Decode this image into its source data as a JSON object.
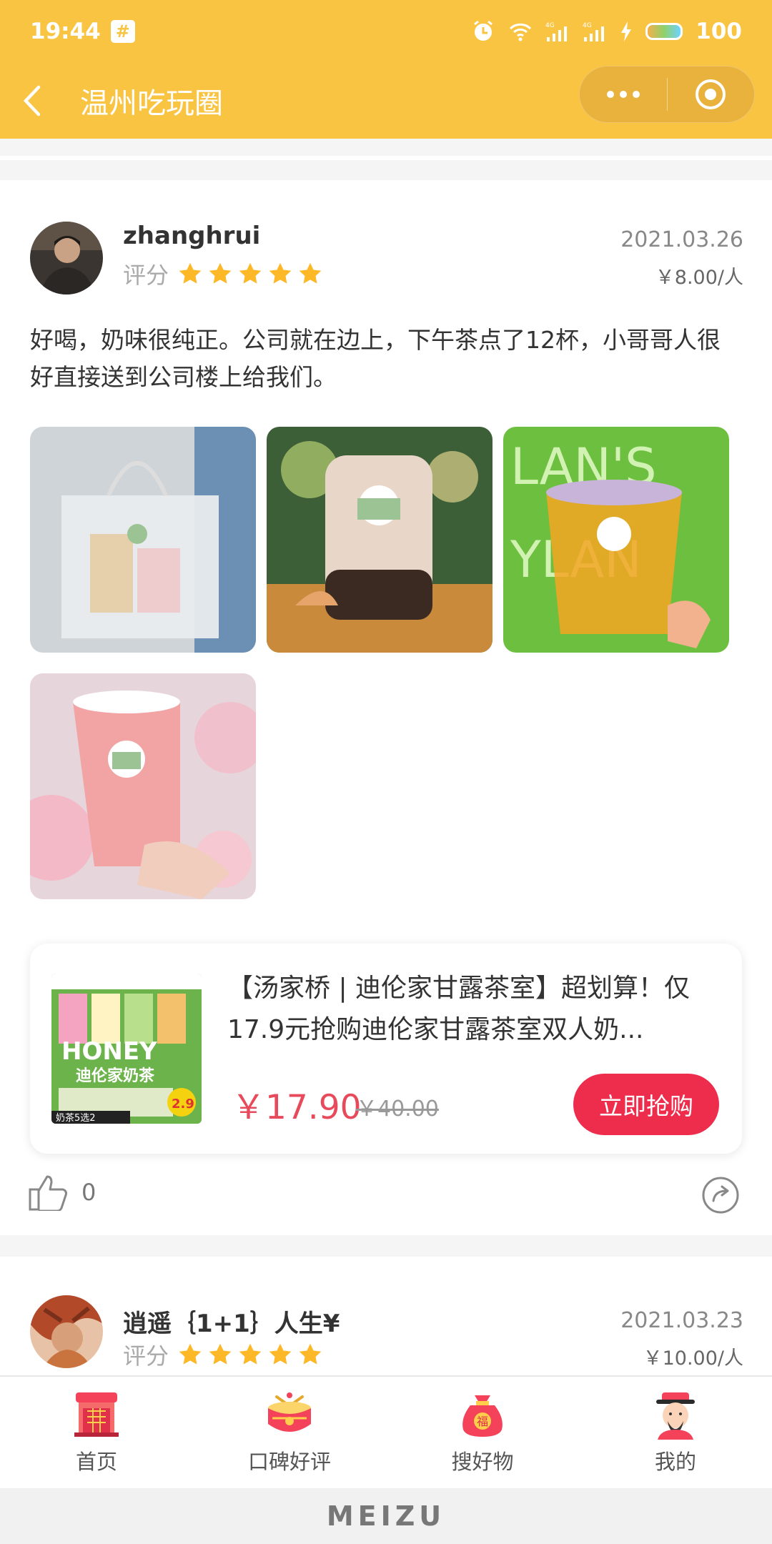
{
  "status_bar": {
    "time": "19:44",
    "hash_icon": "#",
    "battery": "100"
  },
  "nav": {
    "title": "温州吃玩圈"
  },
  "review1": {
    "username": "zhanghrui",
    "rating_label": "评分",
    "stars": 5,
    "date": "2021.03.26",
    "price_per": "￥8.00/人",
    "text": "好喝，奶味很纯正。公司就在边上，下午茶点了12杯，小哥哥人很好直接送到公司楼上给我们。",
    "photo_count": 4
  },
  "deal": {
    "title": "【汤家桥 | 迪伦家甘露茶室】超划算！仅17.9元抢购迪伦家甘露茶室双人奶...",
    "price": "￥17.90",
    "original_price": "￥40.00",
    "buy_label": "立即抢购",
    "image_text": "迪伦家奶茶",
    "image_tag": "奶茶5选2",
    "image_price": "2.9"
  },
  "actions": {
    "like_count": "0"
  },
  "review2": {
    "username": "逍遥｛1+1｝人生¥",
    "rating_label": "评分",
    "stars": 5,
    "date": "2021.03.23",
    "price_per": "￥10.00/人"
  },
  "tabbar": {
    "tabs": [
      {
        "label": "首页",
        "icon": "home-icon"
      },
      {
        "label": "口碑好评",
        "icon": "drum-icon"
      },
      {
        "label": "搜好物",
        "icon": "lucky-bag-icon"
      },
      {
        "label": "我的",
        "icon": "god-of-wealth-icon"
      }
    ]
  },
  "system": {
    "brand": "MEIZU"
  },
  "colors": {
    "theme_yellow": "#fac443",
    "price_red": "#e84a5b",
    "button_red": "#ee2c4c",
    "star": "#fcb827"
  }
}
